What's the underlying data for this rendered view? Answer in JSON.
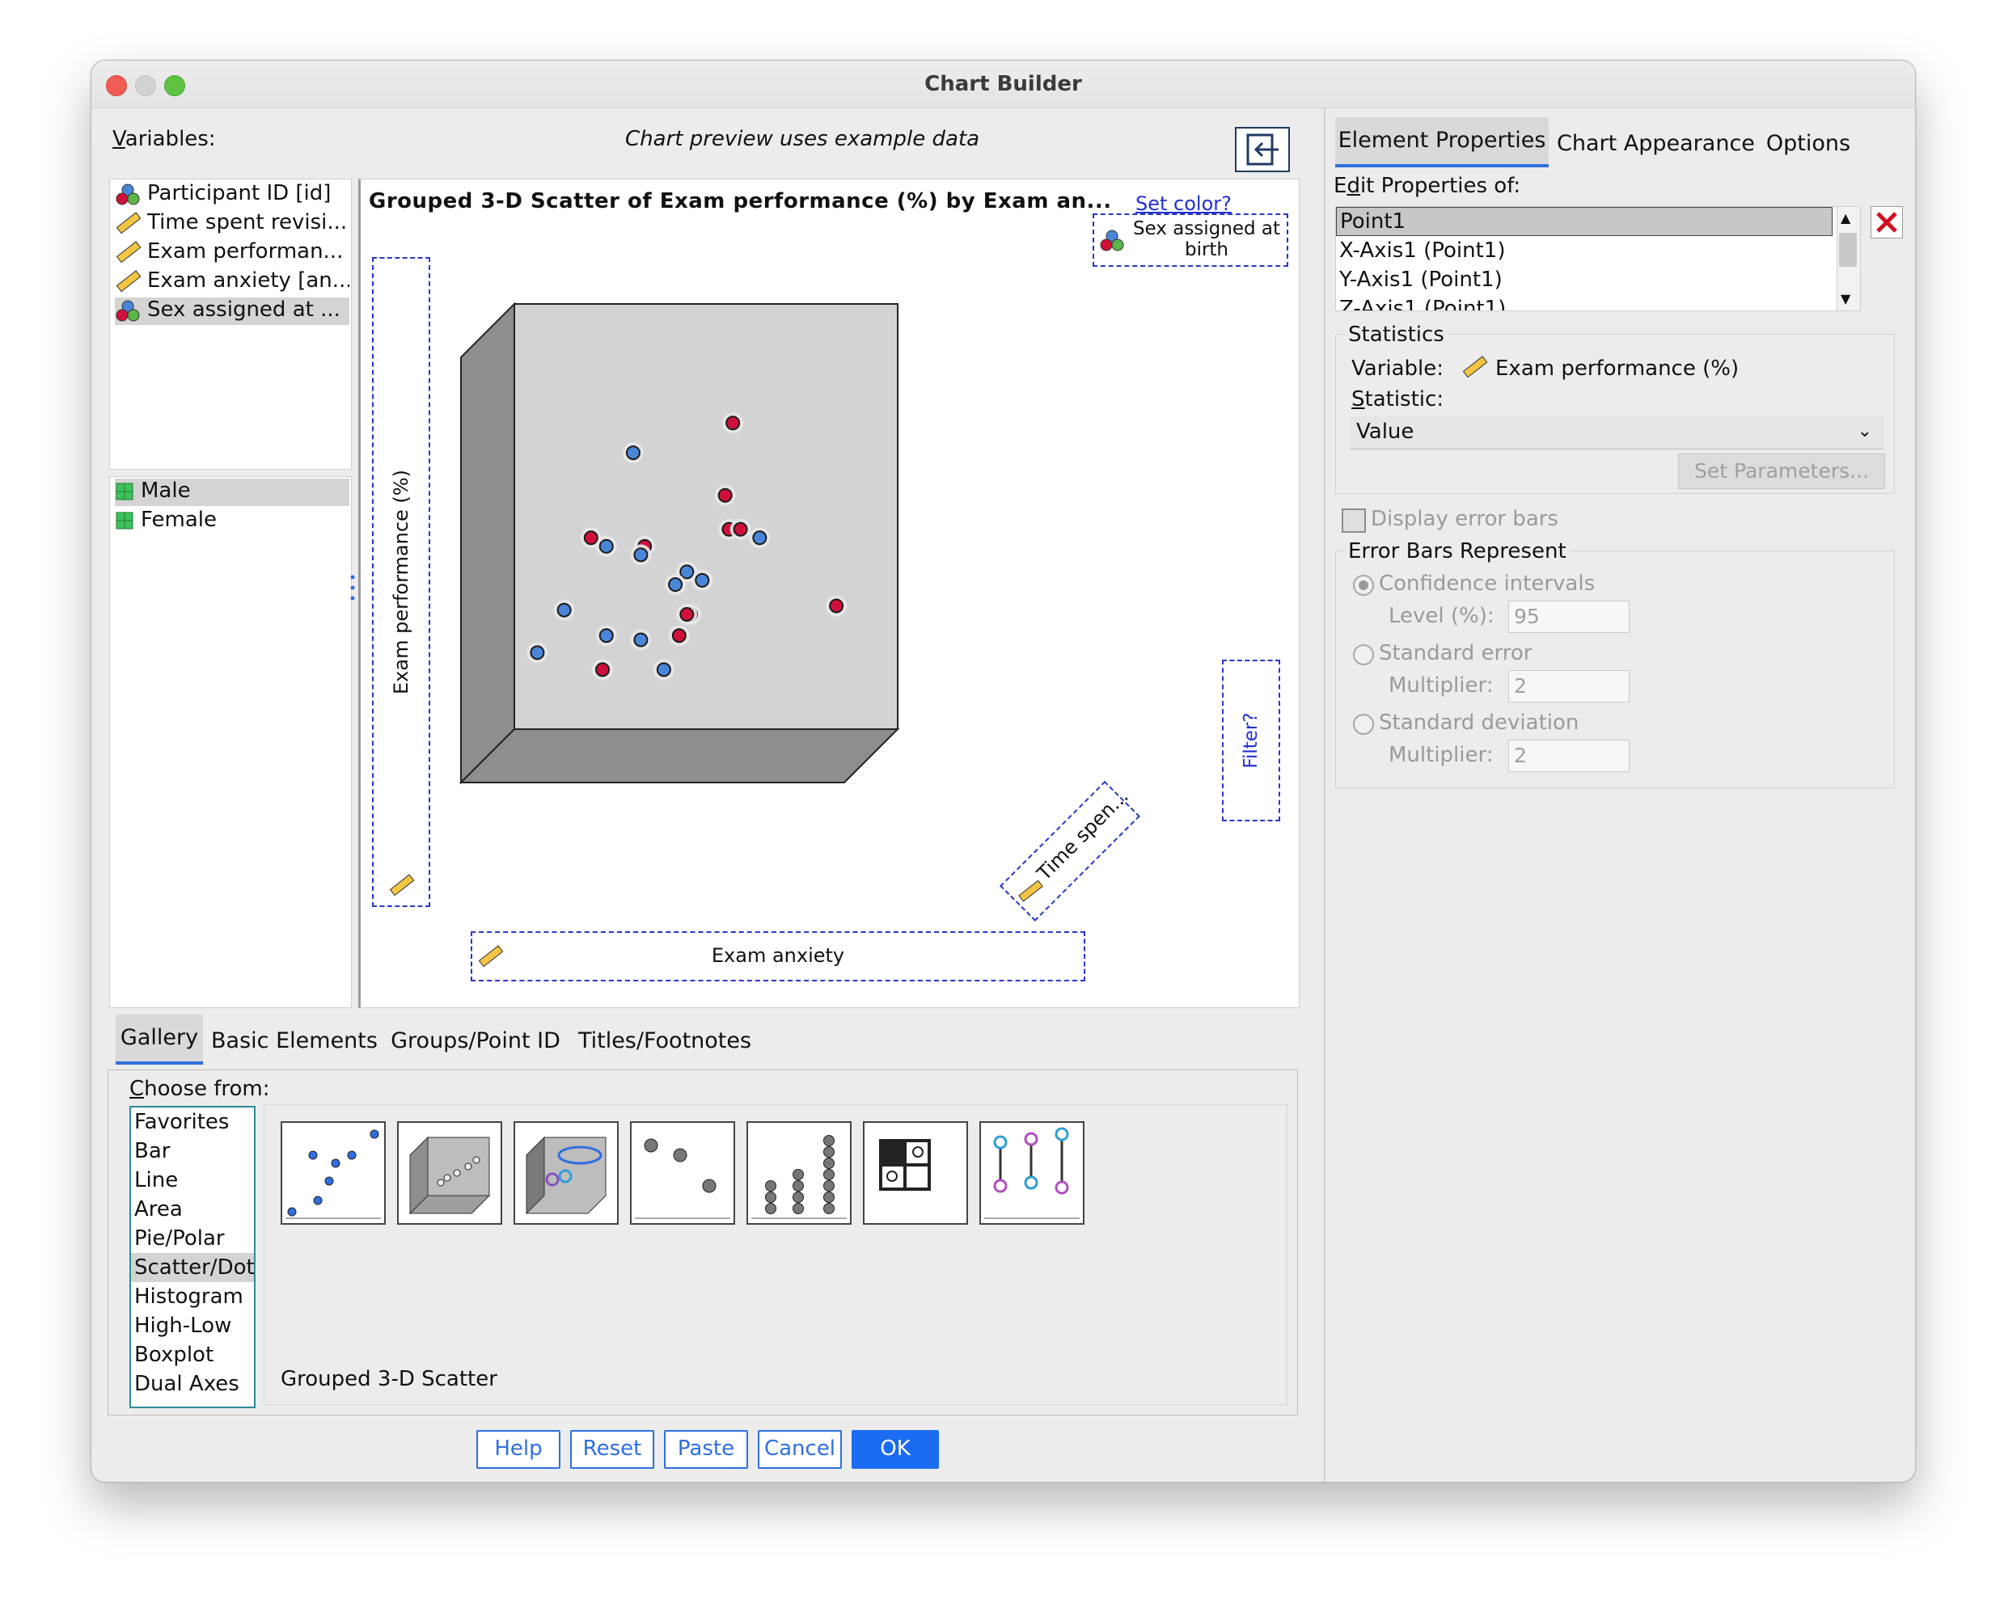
{
  "window": {
    "title": "Chart Builder"
  },
  "variables": {
    "label": "Variables:",
    "items": [
      {
        "label": "Participant ID [id]",
        "icon": "nominal-icon"
      },
      {
        "label": "Time spent revisi...",
        "icon": "scale-ruler-icon"
      },
      {
        "label": "Exam performan...",
        "icon": "scale-ruler-icon"
      },
      {
        "label": "Exam anxiety [an...",
        "icon": "scale-ruler-icon"
      },
      {
        "label": "Sex assigned at ...",
        "icon": "nominal-icon"
      }
    ],
    "categories": [
      {
        "label": "Male"
      },
      {
        "label": "Female"
      }
    ]
  },
  "preview": {
    "note": "Chart preview uses example data",
    "chart_title": "Grouped 3-D Scatter of Exam performance (%) by Exam an...",
    "set_color": "Set color?",
    "color_drop": "Sex assigned at birth",
    "y_drop": "Exam performance (%)",
    "x_drop": "Exam anxiety",
    "z_drop": "Time spen...",
    "filter_drop": "Filter?"
  },
  "chart_data": {
    "type": "scatter",
    "title": "Grouped 3-D Scatter of Exam performance (%) by Exam an...",
    "series": [
      {
        "name": "Male",
        "color": "#d0103a",
        "points": [
          [
            0.57,
            0.28
          ],
          [
            0.55,
            0.45
          ],
          [
            0.56,
            0.53
          ],
          [
            0.59,
            0.53
          ],
          [
            0.2,
            0.55
          ],
          [
            0.34,
            0.57
          ],
          [
            0.46,
            0.73
          ],
          [
            0.84,
            0.71
          ],
          [
            0.43,
            0.78
          ],
          [
            0.23,
            0.86
          ],
          [
            0.45,
            0.73
          ]
        ]
      },
      {
        "name": "Female",
        "color": "#4a86d8",
        "points": [
          [
            0.31,
            0.35
          ],
          [
            0.24,
            0.57
          ],
          [
            0.33,
            0.59
          ],
          [
            0.45,
            0.63
          ],
          [
            0.49,
            0.65
          ],
          [
            0.42,
            0.66
          ],
          [
            0.64,
            0.55
          ],
          [
            0.13,
            0.72
          ],
          [
            0.24,
            0.78
          ],
          [
            0.33,
            0.79
          ],
          [
            0.06,
            0.82
          ],
          [
            0.39,
            0.86
          ]
        ]
      }
    ]
  },
  "gallery": {
    "tabs": [
      "Gallery",
      "Basic Elements",
      "Groups/Point ID",
      "Titles/Footnotes"
    ],
    "choose_label": "Choose from:",
    "types": [
      "Favorites",
      "Bar",
      "Line",
      "Area",
      "Pie/Polar",
      "Scatter/Dot",
      "Histogram",
      "High-Low",
      "Boxplot",
      "Dual Axes"
    ],
    "selected_caption": "Grouped 3-D Scatter"
  },
  "buttons": {
    "help": "Help",
    "reset": "Reset",
    "paste": "Paste",
    "cancel": "Cancel",
    "ok": "OK"
  },
  "right": {
    "tabs": [
      "Element Properties",
      "Chart Appearance",
      "Options"
    ],
    "edit_label": "Edit Properties of:",
    "edit_items": [
      "Point1",
      "X-Axis1 (Point1)",
      "Y-Axis1 (Point1)",
      "Z-Axis1 (Point1)"
    ],
    "statistics": {
      "group": "Statistics",
      "variable_label": "Variable:",
      "variable_value": "Exam performance (%)",
      "statistic_label": "Statistic:",
      "statistic_value": "Value",
      "set_params": "Set Parameters..."
    },
    "display_error_bars": "Display error bars",
    "error_bars": {
      "group": "Error Bars Represent",
      "ci": "Confidence intervals",
      "level_label": "Level (%):",
      "level_value": "95",
      "se": "Standard error",
      "se_mult_label": "Multiplier:",
      "se_mult_value": "2",
      "sd": "Standard deviation",
      "sd_mult_label": "Multiplier:",
      "sd_mult_value": "2"
    }
  },
  "colors": {
    "accent": "#2f6fe0",
    "drop_zone": "#2a36c9",
    "male": "#d0103a",
    "female": "#4a86d8"
  }
}
